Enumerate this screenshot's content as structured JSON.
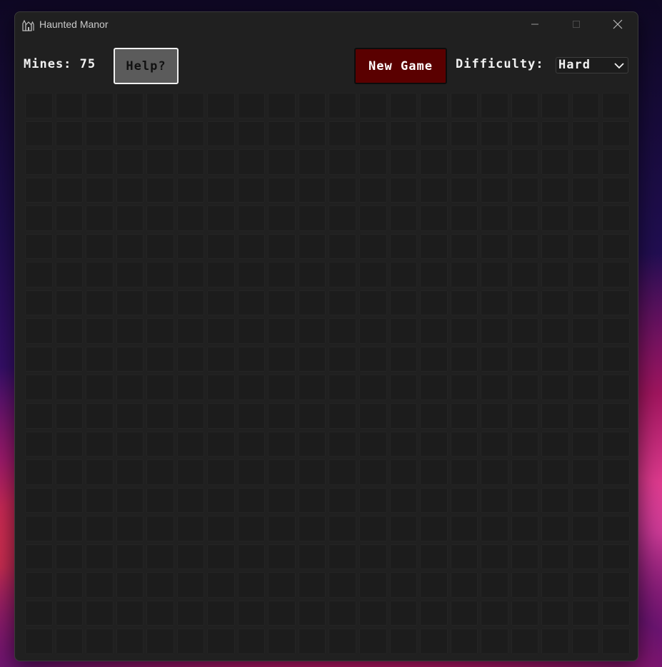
{
  "window": {
    "title": "Haunted Manor",
    "app_icon": "haunted-manor-icon",
    "controls": [
      "minimize-icon",
      "maximize-icon",
      "close-icon"
    ]
  },
  "toolbar": {
    "mines_text": "Mines: 75",
    "help_label": "Help?",
    "new_game_label": "New Game",
    "difficulty_label": "Difficulty:",
    "difficulty_value": "Hard"
  },
  "board": {
    "columns": 20,
    "rows": 20,
    "cell_state": "unrevealed"
  },
  "colors": {
    "window_bg": "#202020",
    "cell_bg": "#1c1c1c",
    "help_button_bg": "#5b5b5b",
    "new_game_bg": "#5a0000",
    "text": "#f2f2f2"
  }
}
